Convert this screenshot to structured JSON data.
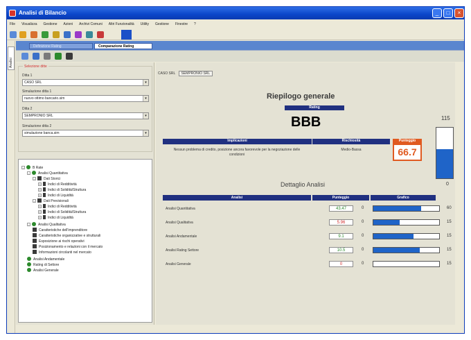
{
  "window": {
    "title": "Analisi di Bilancio"
  },
  "menu": [
    "File",
    "Visualizza",
    "Gestione",
    "Azioni",
    "Archivi Comuni",
    "Altri Funzionalità",
    "Utility",
    "Gestione",
    "Finestre",
    "?"
  ],
  "colors": {
    "accent": "#203080",
    "bar": "#1f64c8",
    "highlight": "#e05a20",
    "tree_icon": "#2c8a2c"
  },
  "sidestrip": {
    "label": "Analisi"
  },
  "tabs": {
    "inactive": "Definizione Rating",
    "active": "Comparazione Rating"
  },
  "left": {
    "legend": "Selezione ditte",
    "fields": [
      {
        "label": "Ditta 1",
        "value": "CASO SRL"
      },
      {
        "label": "Simulazione ditta 1",
        "value": "nuovo ottimo bancario.sim"
      },
      {
        "label": "Ditta 2",
        "value": "SEMPRONIO SRL"
      },
      {
        "label": "Simulazione ditta 2",
        "value": "simulazione banca.sim"
      }
    ],
    "tree": [
      {
        "label": "B Rate",
        "level": 0,
        "icon": "globe",
        "pm": "-"
      },
      {
        "label": "Analisi Quantitativa",
        "level": 1,
        "icon": "globe",
        "pm": "-"
      },
      {
        "label": "Dati Storici",
        "level": 2,
        "icon": "book",
        "pm": "-"
      },
      {
        "label": "Indici di Redditività",
        "level": 3,
        "icon": "fx",
        "pm": "+"
      },
      {
        "label": "Indici di Solidità/Struttura",
        "level": 3,
        "icon": "fx",
        "pm": "+"
      },
      {
        "label": "Indici di Liquidità",
        "level": 3,
        "icon": "fx",
        "pm": "+"
      },
      {
        "label": "Dati Previsionali",
        "level": 2,
        "icon": "book",
        "pm": "-"
      },
      {
        "label": "Indici di Redditività",
        "level": 3,
        "icon": "fx",
        "pm": "+"
      },
      {
        "label": "Indici di Solidità/Struttura",
        "level": 3,
        "icon": "fx",
        "pm": "+"
      },
      {
        "label": "Indici di Liquidità",
        "level": 3,
        "icon": "fx",
        "pm": "+"
      },
      {
        "label": "Analisi Qualitativa",
        "level": 1,
        "icon": "globe",
        "pm": "-"
      },
      {
        "label": "Caratteristiche dell'imprenditore",
        "level": 2,
        "icon": "book",
        "pm": ""
      },
      {
        "label": "Caratteristiche organizzative e strutturali",
        "level": 2,
        "icon": "book",
        "pm": ""
      },
      {
        "label": "Esposizione ai rischi operativi",
        "level": 2,
        "icon": "book",
        "pm": ""
      },
      {
        "label": "Posizionamento e relazioni con il mercato",
        "level": 2,
        "icon": "book",
        "pm": ""
      },
      {
        "label": "Informazioni circolanti nel mercato",
        "level": 2,
        "icon": "book",
        "pm": ""
      },
      {
        "label": "Analisi Andamentale",
        "level": 1,
        "icon": "globe",
        "pm": ""
      },
      {
        "label": "Rating di Settore",
        "level": 1,
        "icon": "globe",
        "pm": ""
      },
      {
        "label": "Analisi Generale",
        "level": 1,
        "icon": "globe",
        "pm": ""
      }
    ]
  },
  "content": {
    "crumb_left": "CASO SRL",
    "crumb_right": "SEMPRONIO SRL",
    "riepilogo_title": "Riepilogo generale",
    "rating_label": "Rating",
    "rating_value": "BBB",
    "implicazioni_label": "Implicazioni",
    "rischiosita_label": "Rischiosità",
    "punteggio_label": "Punteggio",
    "implicazioni_text": "Nessun problema di credito, posizione ancora favorevole per la negoziazione delle condizioni",
    "rischiosita_text": "Medio-Bassa",
    "punteggio_value": "66.7",
    "gauge_max": "115",
    "gauge_min": "0",
    "gauge_level": 0.58,
    "dettaglio_title": "Dettaglio Analisi",
    "dt_headers": {
      "analisi": "Analisi",
      "punteggio": "Punteggio",
      "grafico": "Grafico"
    },
    "rows": [
      {
        "label": "Analisi Quantitativa",
        "score": "43.47",
        "score_color": "#2c8a2c",
        "weight": "0",
        "bar_fraction": 0.73,
        "bar_value": "60"
      },
      {
        "label": "Analisi Qualitativa",
        "score": "5.96",
        "score_color": "#d23030",
        "weight": "0",
        "bar_fraction": 0.4,
        "bar_value": "15"
      },
      {
        "label": "Analisi Andamentale",
        "score": "9.1",
        "score_color": "#2c8a2c",
        "weight": "0",
        "bar_fraction": 0.61,
        "bar_value": "15"
      },
      {
        "label": "Analisi Rating Settore",
        "score": "10.5",
        "score_color": "#2c8a2c",
        "weight": "0",
        "bar_fraction": 0.7,
        "bar_value": "15"
      },
      {
        "label": "Analisi Generale",
        "score": "0",
        "score_color": "#d23030",
        "weight": "0",
        "bar_fraction": 0.0,
        "bar_value": "15"
      }
    ]
  }
}
